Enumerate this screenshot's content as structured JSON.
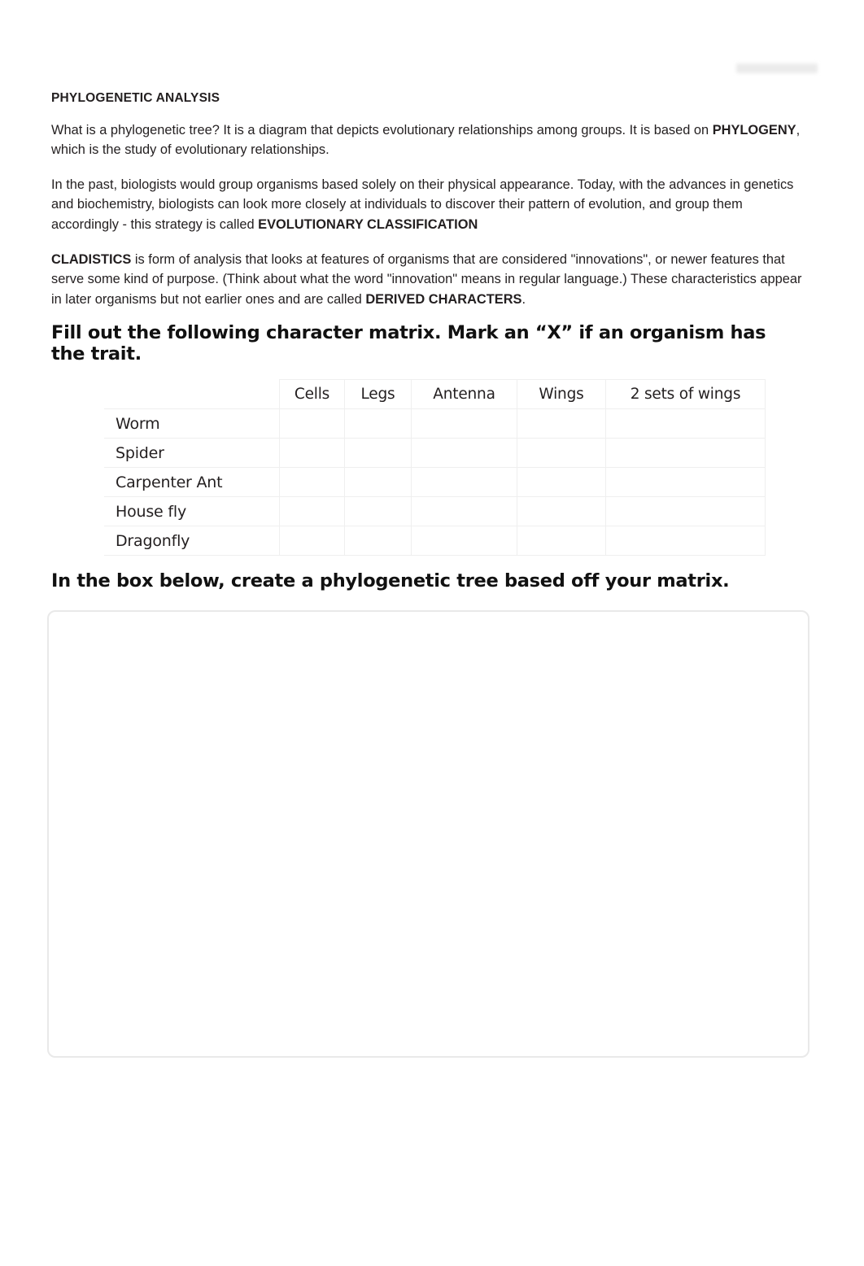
{
  "document": {
    "heading": "PHYLOGENETIC ANALYSIS",
    "paragraphs": [
      {
        "id": "p1",
        "runs": [
          {
            "text": "What is a phylogenetic tree? It is a diagram that depicts evolutionary relationships among groups. It is based on ",
            "bold": false
          },
          {
            "text": "PHYLOGENY",
            "bold": true
          },
          {
            "text": ", which is the study of evolutionary relationships.",
            "bold": false
          }
        ]
      },
      {
        "id": "p2",
        "runs": [
          {
            "text": "In the past, biologists would group organisms based solely on their physical appearance. Today, with the advances in genetics and biochemistry, biologists can look more closely at individuals to discover their pattern of evolution, and group them accordingly - this strategy is called ",
            "bold": false
          },
          {
            "text": "EVOLUTIONARY CLASSIFICATION",
            "bold": true
          }
        ]
      },
      {
        "id": "p3",
        "runs": [
          {
            "text": "CLADISTICS",
            "bold": true
          },
          {
            "text": " is form of analysis that looks at features of organisms that are considered \"innovations\", or newer features that serve some kind of purpose. (Think about what the word \"innovation\" means in regular language.) These characteristics appear in later organisms but not earlier ones and are called ",
            "bold": false
          },
          {
            "text": "DERIVED CHARACTERS",
            "bold": true
          },
          {
            "text": ".",
            "bold": false
          }
        ]
      }
    ],
    "section_headings": {
      "matrix": "Fill out the following character matrix. Mark an “X” if an organism has the trait.",
      "tree": "In the box below, create a phylogenetic tree based off your matrix."
    },
    "redaction_label": "redacted-mark"
  },
  "matrix": {
    "corner_label": "",
    "columns": [
      "Cells",
      "Legs",
      "Antenna",
      "Wings",
      "2 sets of wings"
    ],
    "rows": [
      {
        "organism": "Worm",
        "marks": [
          "",
          "",
          "",
          "",
          ""
        ]
      },
      {
        "organism": "Spider",
        "marks": [
          "",
          "",
          "",
          "",
          ""
        ]
      },
      {
        "organism": "Carpenter Ant",
        "marks": [
          "",
          "",
          "",
          "",
          ""
        ]
      },
      {
        "organism": "House fly",
        "marks": [
          "",
          "",
          "",
          "",
          ""
        ]
      },
      {
        "organism": "Dragonfly",
        "marks": [
          "",
          "",
          "",
          "",
          ""
        ]
      }
    ]
  },
  "answer_box": {
    "content": "",
    "placeholder": ""
  },
  "colors": {
    "text": "#231f20",
    "heading": "#111111",
    "table_border": "#efefef",
    "box_border": "#e9e9e9",
    "page_background": "#ffffff"
  }
}
